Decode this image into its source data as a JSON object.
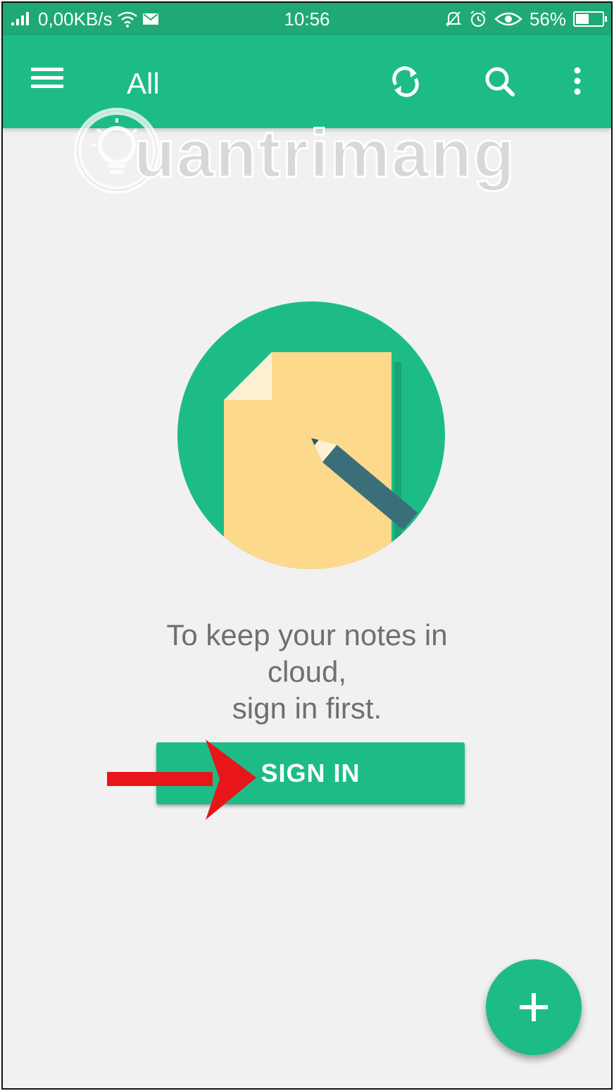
{
  "status_bar": {
    "network_speed": "0,00KB/s",
    "time": "10:56",
    "battery_percent": "56%",
    "battery_level": 0.56,
    "icons": [
      "signal-icon",
      "wifi-icon",
      "message-icon",
      "silent-icon",
      "alarm-icon",
      "eye-icon",
      "battery-icon"
    ]
  },
  "app_bar": {
    "title": "All",
    "actions": [
      "menu-icon",
      "sync-icon",
      "search-icon",
      "more-vert-icon"
    ]
  },
  "watermark": {
    "text": "uantrimang"
  },
  "empty_state": {
    "message_lines": [
      "To keep your notes in",
      "cloud,",
      "sign in first."
    ],
    "illustration": "note-with-pencil-icon"
  },
  "sign_in_button": {
    "label": "SIGN IN"
  },
  "fab": {
    "icon": "plus-icon"
  },
  "colors": {
    "primary": "#1dbc87",
    "status_bar": "#1faa75",
    "background": "#f1f1f1",
    "text_secondary": "#6f6f6f",
    "arrow": "#e8151b",
    "note_paper": "#fdd98b",
    "pencil": "#3a6f7a"
  }
}
